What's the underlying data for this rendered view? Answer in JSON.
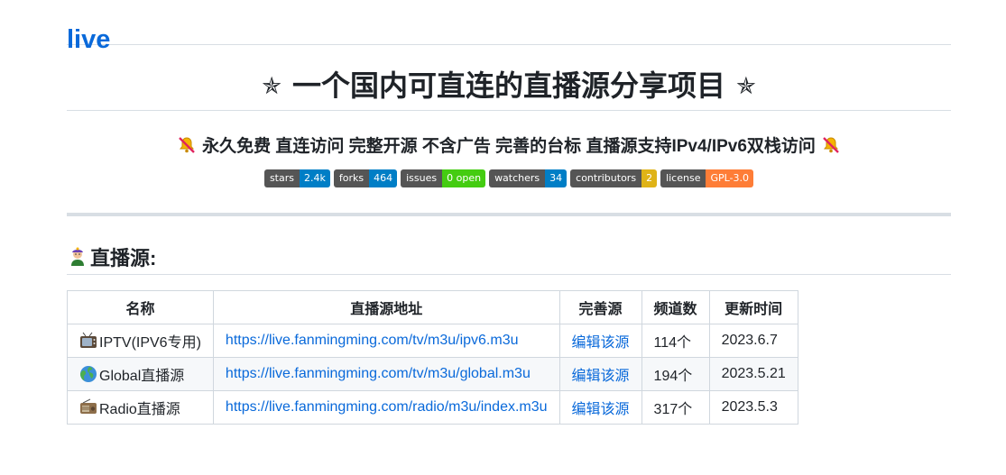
{
  "repo": {
    "name": "live"
  },
  "headline": {
    "star_left": "✯",
    "text": "一个国内可直连的直播源分享项目",
    "star_right": "✯"
  },
  "tagline": {
    "text": "永久免费 直连访问 完整开源 不含广告 完善的台标 直播源支持IPv4/IPv6双栈访问"
  },
  "badges": [
    {
      "key": "stars",
      "value": "2.4k",
      "color": "#007ec6"
    },
    {
      "key": "forks",
      "value": "464",
      "color": "#007ec6"
    },
    {
      "key": "issues",
      "value": "0 open",
      "color": "#4c1"
    },
    {
      "key": "watchers",
      "value": "34",
      "color": "#007ec6"
    },
    {
      "key": "contributors",
      "value": "2",
      "color": "#dfb317"
    },
    {
      "key": "license",
      "value": "GPL-3.0",
      "color": "#fe7d37"
    }
  ],
  "section": {
    "title": "直播源:",
    "icon": "genie-icon"
  },
  "table": {
    "headers": [
      "名称",
      "直播源地址",
      "完善源",
      "频道数",
      "更新时间"
    ],
    "rows": [
      {
        "icon": "tv-icon",
        "name": "IPTV(IPV6专用)",
        "url": "https://live.fanmingming.com/tv/m3u/ipv6.m3u",
        "edit": "编辑该源",
        "channels": "114个",
        "updated": "2023.6.7"
      },
      {
        "icon": "globe-icon",
        "name": "Global直播源",
        "url": "https://live.fanmingming.com/tv/m3u/global.m3u",
        "edit": "编辑该源",
        "channels": "194个",
        "updated": "2023.5.21"
      },
      {
        "icon": "radio-icon",
        "name": "Radio直播源",
        "url": "https://live.fanmingming.com/radio/m3u/index.m3u",
        "edit": "编辑该源",
        "channels": "317个",
        "updated": "2023.5.3"
      }
    ]
  }
}
